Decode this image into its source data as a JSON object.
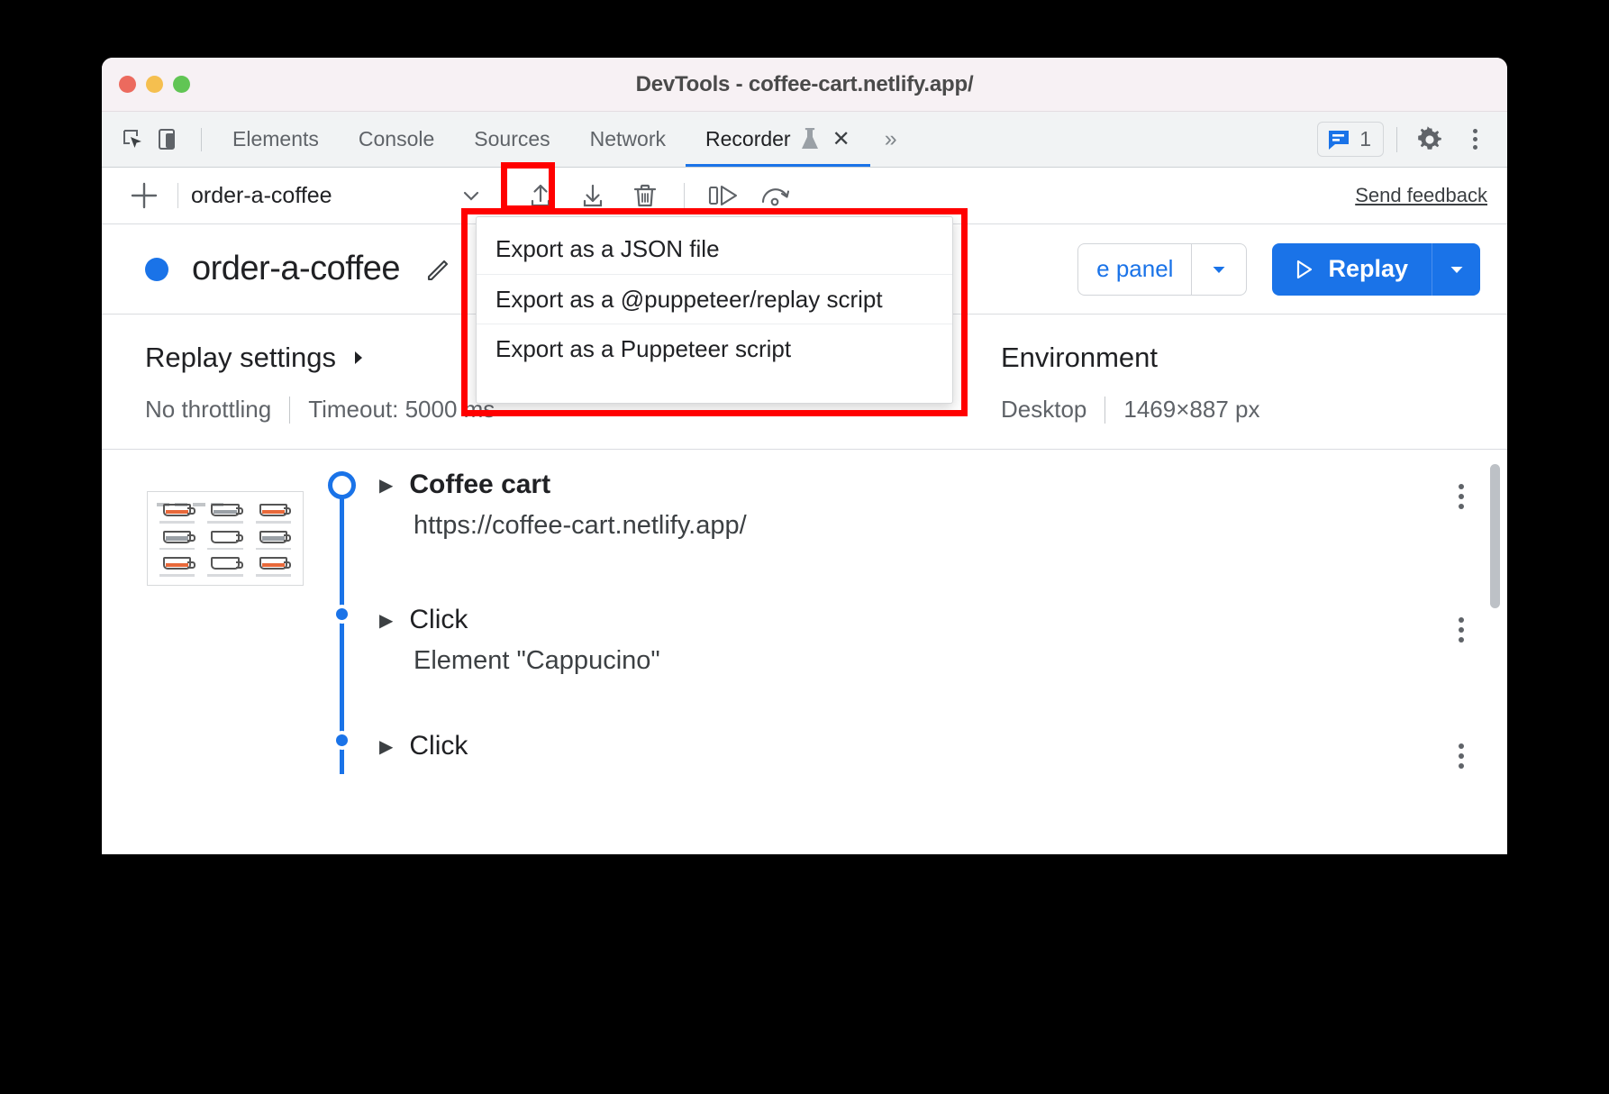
{
  "window": {
    "title": "DevTools - coffee-cart.netlify.app/",
    "traffic_lights": [
      "close",
      "minimize",
      "zoom"
    ]
  },
  "devtools_tabbar": {
    "left_icons": [
      {
        "name": "inspect-element-icon",
        "label": "Inspect element"
      },
      {
        "name": "device-toolbar-icon",
        "label": "Toggle device toolbar"
      }
    ],
    "tabs": [
      {
        "label": "Elements",
        "active": false
      },
      {
        "label": "Console",
        "active": false
      },
      {
        "label": "Sources",
        "active": false
      },
      {
        "label": "Network",
        "active": false
      },
      {
        "label": "Recorder",
        "active": true,
        "experimental": true,
        "closeable": true
      }
    ],
    "more_tabs_label": "»",
    "issues": {
      "icon": "issues-icon",
      "count": "1"
    },
    "settings_label": "Settings",
    "more_options_label": "More options"
  },
  "recorder_toolbar": {
    "add_label": "+",
    "selected_recording": "order-a-coffee",
    "dropdown_caret": "chevron-down-icon",
    "actions": [
      {
        "name": "import-recording-icon",
        "label": "Import recording"
      },
      {
        "name": "export-recording-icon",
        "label": "Export recording",
        "highlighted": true
      },
      {
        "name": "delete-recording-icon",
        "label": "Delete recording"
      },
      {
        "name": "step-by-step-replay-icon",
        "label": "Replay step by step"
      },
      {
        "name": "slow-replay-icon",
        "label": "Replay speed"
      }
    ],
    "send_feedback_label": "Send feedback"
  },
  "export_menu": {
    "visible": true,
    "highlight_color": "#ff0000",
    "items": [
      {
        "label": "Export as a JSON file"
      },
      {
        "label": "Export as a @puppeteer/replay script"
      },
      {
        "label": "Export as a Puppeteer script"
      }
    ]
  },
  "recording_header": {
    "status_dot_color": "#1a73e8",
    "title": "order-a-coffee",
    "edit_label": "Edit title",
    "measure_button_label": "e panel",
    "measure_caret": "chevron-down-icon",
    "replay_label": "Replay",
    "replay_icon": "play-icon",
    "replay_caret": "chevron-down-icon",
    "accent_color": "#1a73e8"
  },
  "settings": {
    "replay_settings_title": "Replay settings",
    "replay_settings_caret": "chevron-right-icon",
    "throttling": "No throttling",
    "timeout": "Timeout: 5000 ms",
    "environment_title": "Environment",
    "environment_device": "Desktop",
    "environment_viewport": "1469×887 px"
  },
  "steps": [
    {
      "type": "start",
      "title": "Coffee cart",
      "subtitle": "https://coffee-cart.netlify.app/",
      "has_thumbnail": true,
      "caret": "chevron-right-icon",
      "menu": "step-options"
    },
    {
      "type": "click",
      "title": "Click",
      "subtitle": "Element \"Cappucino\"",
      "has_thumbnail": false,
      "caret": "chevron-right-icon",
      "menu": "step-options"
    },
    {
      "type": "click",
      "title": "Click",
      "subtitle": "",
      "has_thumbnail": false,
      "caret": "chevron-right-icon",
      "menu": "step-options"
    }
  ]
}
